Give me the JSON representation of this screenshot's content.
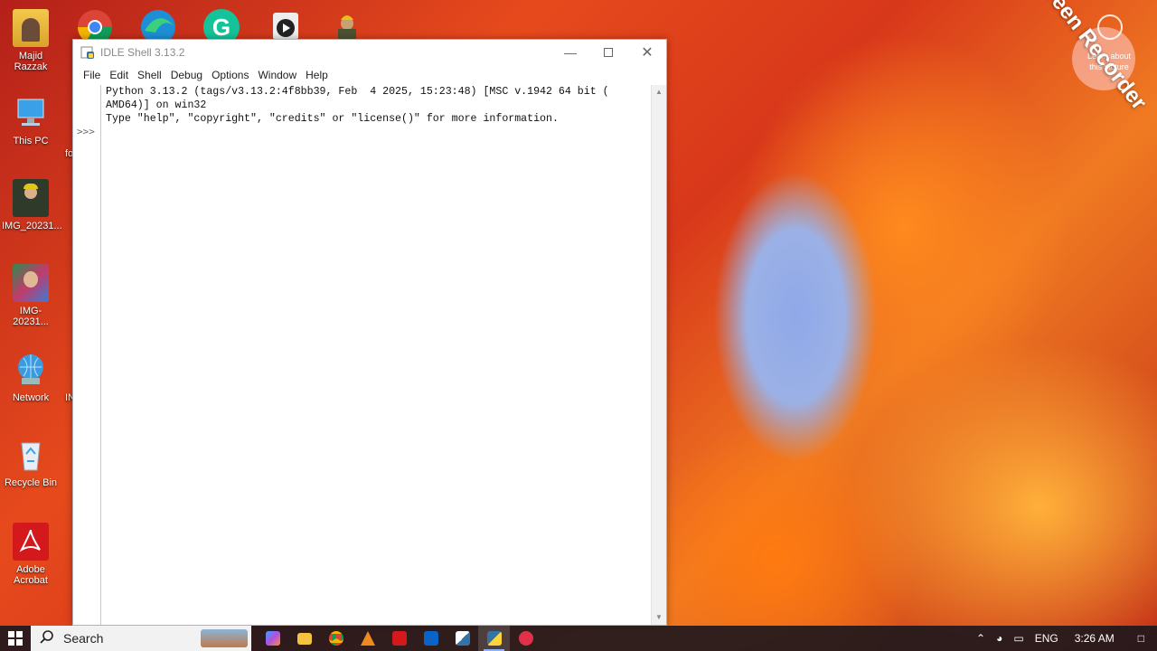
{
  "desktop": {
    "icons": [
      {
        "label": "Majid Razzak",
        "icon": "user-folder-icon"
      },
      {
        "label": "This PC",
        "icon": "computer-icon"
      },
      {
        "label": "IMG_20231...",
        "icon": "image-icon"
      },
      {
        "label": "IMG-20231...",
        "icon": "image-icon"
      },
      {
        "label": "Network",
        "icon": "network-icon"
      },
      {
        "label": "Recycle Bin",
        "icon": "recycle-bin-icon"
      },
      {
        "label": "Adobe Acrobat",
        "icon": "acrobat-icon"
      }
    ],
    "partial_labels": [
      "fo",
      "IN"
    ],
    "top_row_icons": [
      "chrome-icon",
      "edge-icon",
      "grammarly-icon",
      "media-player-icon",
      "user-avatar-icon"
    ],
    "watermark": "iTop Screen Recorder",
    "wallpaper_overlay_text": "Learn about this picture"
  },
  "idle_window": {
    "title": "IDLE Shell 3.13.2",
    "menu": [
      "File",
      "Edit",
      "Shell",
      "Debug",
      "Options",
      "Window",
      "Help"
    ],
    "prompt": ">>>",
    "output_lines": [
      "Python 3.13.2 (tags/v3.13.2:4f8bb39, Feb  4 2025, 15:23:48) [MSC v.1942 64 bit (",
      "AMD64)] on win32",
      "Type \"help\", \"copyright\", \"credits\" or \"license()\" for more information."
    ]
  },
  "taskbar": {
    "search_label": "Search",
    "apps": [
      "copilot-icon",
      "file-explorer-icon",
      "chrome-icon",
      "vlc-icon",
      "acrobat-icon",
      "outlook-icon",
      "python-idle-icon",
      "python-idle-active-icon",
      "screen-recorder-icon"
    ],
    "tray": {
      "language": "ENG",
      "time": "3:26 AM"
    }
  },
  "colors": {
    "taskbar_bg": "#201c1e",
    "idle_text": "#111111",
    "prompt": "#6a6a6a"
  }
}
